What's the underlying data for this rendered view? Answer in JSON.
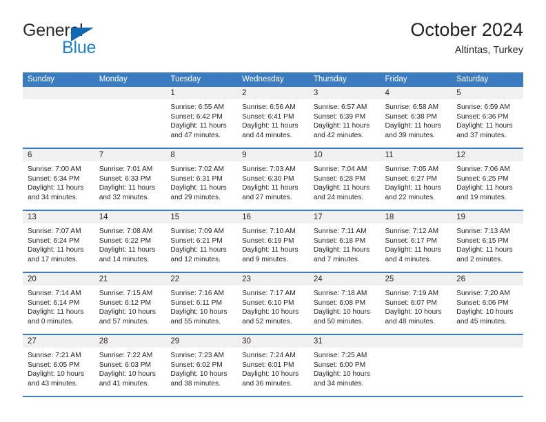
{
  "brand": {
    "name_part1": "General",
    "name_part2": "Blue",
    "triangle_icon": "brand-triangle-icon",
    "color_dark": "#2b2b2b",
    "color_blue": "#1b7fd4"
  },
  "header": {
    "title": "October 2024",
    "subtitle": "Altintas, Turkey"
  },
  "theme": {
    "header_bg": "#3b7cc0",
    "header_text": "#ffffff",
    "day_band_bg": "#f0f0f0",
    "rule_color": "#3b7cc0",
    "body_text": "#231f20"
  },
  "weekday_headers": [
    "Sunday",
    "Monday",
    "Tuesday",
    "Wednesday",
    "Thursday",
    "Friday",
    "Saturday"
  ],
  "weeks": [
    [
      {
        "date": "",
        "sunrise": "",
        "sunset": "",
        "daylight1": "",
        "daylight2": ""
      },
      {
        "date": "",
        "sunrise": "",
        "sunset": "",
        "daylight1": "",
        "daylight2": ""
      },
      {
        "date": "1",
        "sunrise": "Sunrise: 6:55 AM",
        "sunset": "Sunset: 6:42 PM",
        "daylight1": "Daylight: 11 hours",
        "daylight2": "and 47 minutes."
      },
      {
        "date": "2",
        "sunrise": "Sunrise: 6:56 AM",
        "sunset": "Sunset: 6:41 PM",
        "daylight1": "Daylight: 11 hours",
        "daylight2": "and 44 minutes."
      },
      {
        "date": "3",
        "sunrise": "Sunrise: 6:57 AM",
        "sunset": "Sunset: 6:39 PM",
        "daylight1": "Daylight: 11 hours",
        "daylight2": "and 42 minutes."
      },
      {
        "date": "4",
        "sunrise": "Sunrise: 6:58 AM",
        "sunset": "Sunset: 6:38 PM",
        "daylight1": "Daylight: 11 hours",
        "daylight2": "and 39 minutes."
      },
      {
        "date": "5",
        "sunrise": "Sunrise: 6:59 AM",
        "sunset": "Sunset: 6:36 PM",
        "daylight1": "Daylight: 11 hours",
        "daylight2": "and 37 minutes."
      }
    ],
    [
      {
        "date": "6",
        "sunrise": "Sunrise: 7:00 AM",
        "sunset": "Sunset: 6:34 PM",
        "daylight1": "Daylight: 11 hours",
        "daylight2": "and 34 minutes."
      },
      {
        "date": "7",
        "sunrise": "Sunrise: 7:01 AM",
        "sunset": "Sunset: 6:33 PM",
        "daylight1": "Daylight: 11 hours",
        "daylight2": "and 32 minutes."
      },
      {
        "date": "8",
        "sunrise": "Sunrise: 7:02 AM",
        "sunset": "Sunset: 6:31 PM",
        "daylight1": "Daylight: 11 hours",
        "daylight2": "and 29 minutes."
      },
      {
        "date": "9",
        "sunrise": "Sunrise: 7:03 AM",
        "sunset": "Sunset: 6:30 PM",
        "daylight1": "Daylight: 11 hours",
        "daylight2": "and 27 minutes."
      },
      {
        "date": "10",
        "sunrise": "Sunrise: 7:04 AM",
        "sunset": "Sunset: 6:28 PM",
        "daylight1": "Daylight: 11 hours",
        "daylight2": "and 24 minutes."
      },
      {
        "date": "11",
        "sunrise": "Sunrise: 7:05 AM",
        "sunset": "Sunset: 6:27 PM",
        "daylight1": "Daylight: 11 hours",
        "daylight2": "and 22 minutes."
      },
      {
        "date": "12",
        "sunrise": "Sunrise: 7:06 AM",
        "sunset": "Sunset: 6:25 PM",
        "daylight1": "Daylight: 11 hours",
        "daylight2": "and 19 minutes."
      }
    ],
    [
      {
        "date": "13",
        "sunrise": "Sunrise: 7:07 AM",
        "sunset": "Sunset: 6:24 PM",
        "daylight1": "Daylight: 11 hours",
        "daylight2": "and 17 minutes."
      },
      {
        "date": "14",
        "sunrise": "Sunrise: 7:08 AM",
        "sunset": "Sunset: 6:22 PM",
        "daylight1": "Daylight: 11 hours",
        "daylight2": "and 14 minutes."
      },
      {
        "date": "15",
        "sunrise": "Sunrise: 7:09 AM",
        "sunset": "Sunset: 6:21 PM",
        "daylight1": "Daylight: 11 hours",
        "daylight2": "and 12 minutes."
      },
      {
        "date": "16",
        "sunrise": "Sunrise: 7:10 AM",
        "sunset": "Sunset: 6:19 PM",
        "daylight1": "Daylight: 11 hours",
        "daylight2": "and 9 minutes."
      },
      {
        "date": "17",
        "sunrise": "Sunrise: 7:11 AM",
        "sunset": "Sunset: 6:18 PM",
        "daylight1": "Daylight: 11 hours",
        "daylight2": "and 7 minutes."
      },
      {
        "date": "18",
        "sunrise": "Sunrise: 7:12 AM",
        "sunset": "Sunset: 6:17 PM",
        "daylight1": "Daylight: 11 hours",
        "daylight2": "and 4 minutes."
      },
      {
        "date": "19",
        "sunrise": "Sunrise: 7:13 AM",
        "sunset": "Sunset: 6:15 PM",
        "daylight1": "Daylight: 11 hours",
        "daylight2": "and 2 minutes."
      }
    ],
    [
      {
        "date": "20",
        "sunrise": "Sunrise: 7:14 AM",
        "sunset": "Sunset: 6:14 PM",
        "daylight1": "Daylight: 11 hours",
        "daylight2": "and 0 minutes."
      },
      {
        "date": "21",
        "sunrise": "Sunrise: 7:15 AM",
        "sunset": "Sunset: 6:12 PM",
        "daylight1": "Daylight: 10 hours",
        "daylight2": "and 57 minutes."
      },
      {
        "date": "22",
        "sunrise": "Sunrise: 7:16 AM",
        "sunset": "Sunset: 6:11 PM",
        "daylight1": "Daylight: 10 hours",
        "daylight2": "and 55 minutes."
      },
      {
        "date": "23",
        "sunrise": "Sunrise: 7:17 AM",
        "sunset": "Sunset: 6:10 PM",
        "daylight1": "Daylight: 10 hours",
        "daylight2": "and 52 minutes."
      },
      {
        "date": "24",
        "sunrise": "Sunrise: 7:18 AM",
        "sunset": "Sunset: 6:08 PM",
        "daylight1": "Daylight: 10 hours",
        "daylight2": "and 50 minutes."
      },
      {
        "date": "25",
        "sunrise": "Sunrise: 7:19 AM",
        "sunset": "Sunset: 6:07 PM",
        "daylight1": "Daylight: 10 hours",
        "daylight2": "and 48 minutes."
      },
      {
        "date": "26",
        "sunrise": "Sunrise: 7:20 AM",
        "sunset": "Sunset: 6:06 PM",
        "daylight1": "Daylight: 10 hours",
        "daylight2": "and 45 minutes."
      }
    ],
    [
      {
        "date": "27",
        "sunrise": "Sunrise: 7:21 AM",
        "sunset": "Sunset: 6:05 PM",
        "daylight1": "Daylight: 10 hours",
        "daylight2": "and 43 minutes."
      },
      {
        "date": "28",
        "sunrise": "Sunrise: 7:22 AM",
        "sunset": "Sunset: 6:03 PM",
        "daylight1": "Daylight: 10 hours",
        "daylight2": "and 41 minutes."
      },
      {
        "date": "29",
        "sunrise": "Sunrise: 7:23 AM",
        "sunset": "Sunset: 6:02 PM",
        "daylight1": "Daylight: 10 hours",
        "daylight2": "and 38 minutes."
      },
      {
        "date": "30",
        "sunrise": "Sunrise: 7:24 AM",
        "sunset": "Sunset: 6:01 PM",
        "daylight1": "Daylight: 10 hours",
        "daylight2": "and 36 minutes."
      },
      {
        "date": "31",
        "sunrise": "Sunrise: 7:25 AM",
        "sunset": "Sunset: 6:00 PM",
        "daylight1": "Daylight: 10 hours",
        "daylight2": "and 34 minutes."
      },
      {
        "date": "",
        "sunrise": "",
        "sunset": "",
        "daylight1": "",
        "daylight2": ""
      },
      {
        "date": "",
        "sunrise": "",
        "sunset": "",
        "daylight1": "",
        "daylight2": ""
      }
    ]
  ]
}
